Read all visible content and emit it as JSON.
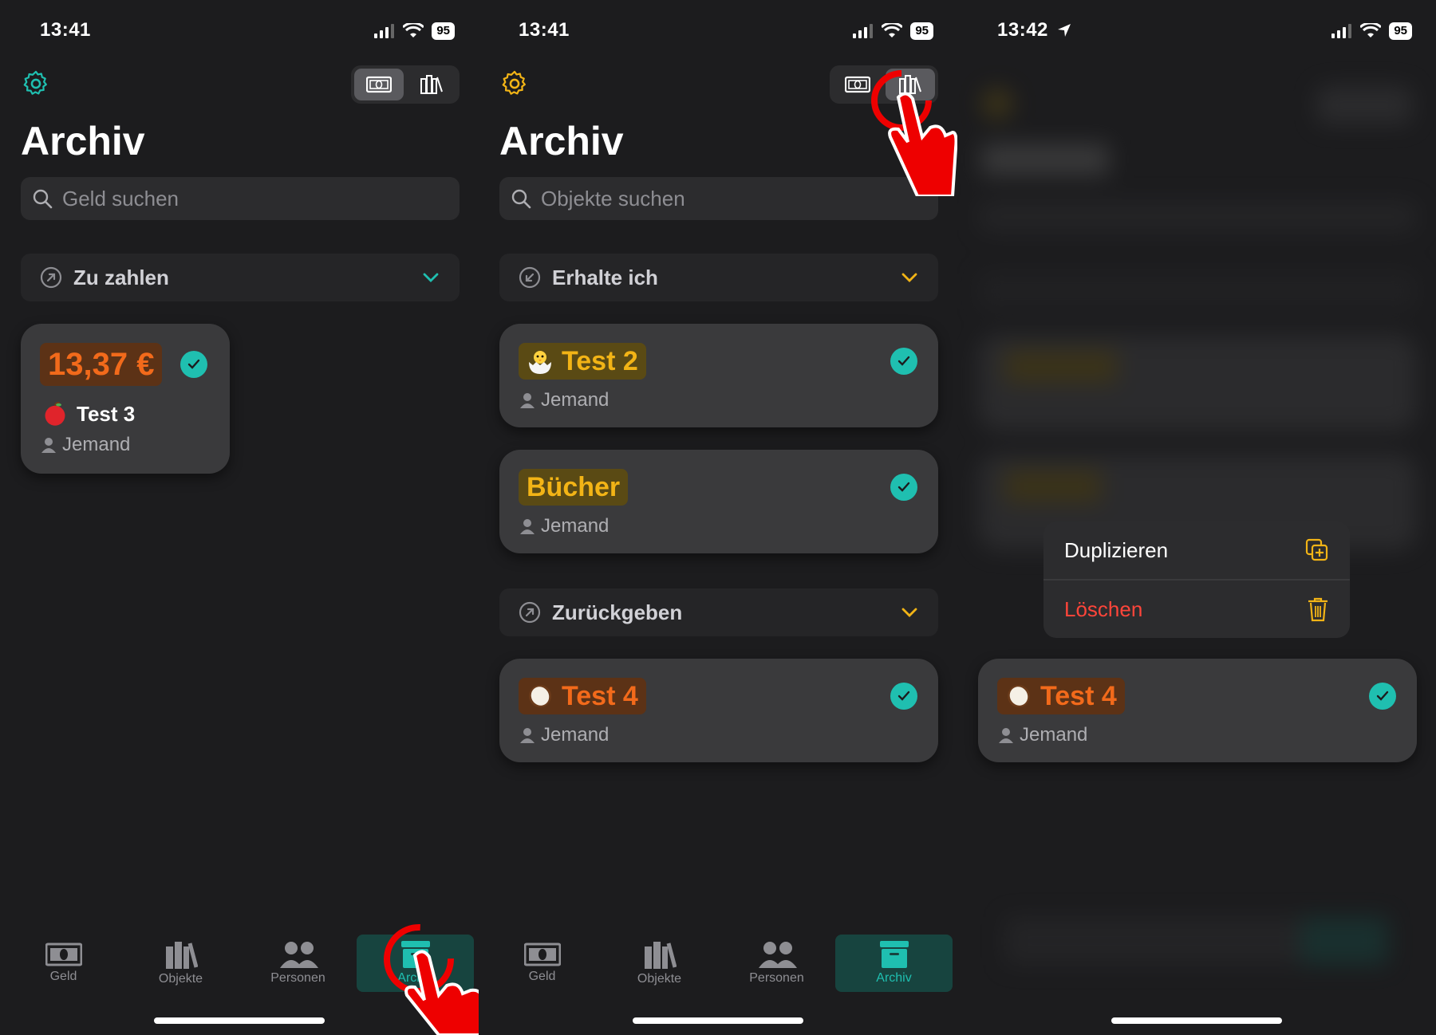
{
  "colors": {
    "accent_teal": "#1fbfb0",
    "accent_yellow": "#f2b416",
    "accent_orange": "#f26a1b",
    "danger_red": "#ff453a"
  },
  "panel1": {
    "time": "13:41",
    "battery": "95",
    "title": "Archiv",
    "search_placeholder": "Geld suchen",
    "section": {
      "label": "Zu zahlen",
      "chevron_color": "teal"
    },
    "card": {
      "amount": "13,37 €",
      "name": "Test 3",
      "person": "Jemand",
      "emoji": "red-apple-icon"
    },
    "tabs": [
      {
        "label": "Geld"
      },
      {
        "label": "Objekte"
      },
      {
        "label": "Personen"
      },
      {
        "label": "Archiv",
        "active": true
      }
    ]
  },
  "panel2": {
    "time": "13:41",
    "battery": "95",
    "title": "Archiv",
    "search_placeholder": "Objekte suchen",
    "section1": {
      "label": "Erhalte ich"
    },
    "section2": {
      "label": "Zurückgeben"
    },
    "cards": [
      {
        "name": "Test 2",
        "person": "Jemand",
        "emoji": "hatching-chick-icon",
        "color": "yellow"
      },
      {
        "name": "Bücher",
        "person": "Jemand",
        "emoji": "",
        "color": "yellow"
      },
      {
        "name": "Test 4",
        "person": "Jemand",
        "emoji": "coconut-icon",
        "color": "orange"
      }
    ],
    "tabs": [
      {
        "label": "Geld"
      },
      {
        "label": "Objekte"
      },
      {
        "label": "Personen"
      },
      {
        "label": "Archiv",
        "active": true
      }
    ]
  },
  "panel3": {
    "time": "13:42",
    "battery": "95",
    "menu": {
      "duplicate": "Duplizieren",
      "delete": "Löschen"
    },
    "card": {
      "name": "Test 4",
      "person": "Jemand",
      "emoji": "coconut-icon"
    }
  }
}
